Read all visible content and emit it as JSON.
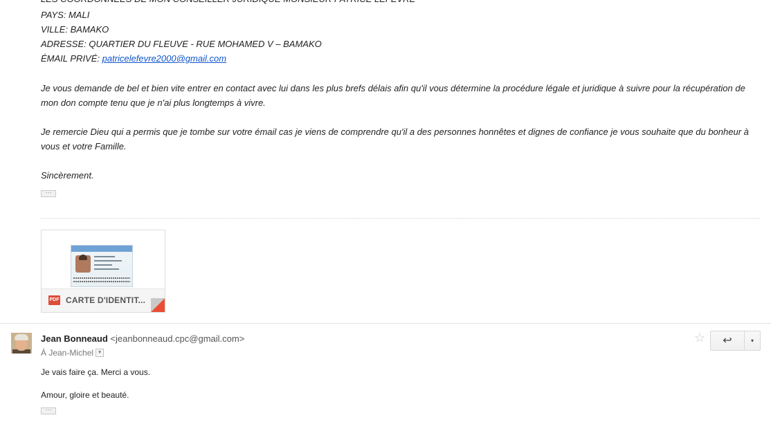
{
  "message1": {
    "cut_line": "LES COORDONNÉES DE MON CONSEILLER JURIDIQUE MONSIEUR PATRICE LEFEVRE",
    "pays": "PAYS: MALI",
    "ville": "VILLE: BAMAKO",
    "adresse": "ADRESSE: QUARTIER DU FLEUVE - RUE MOHAMED V – BAMAKO",
    "email_label": "ÉMAIL PRIVÉ: ",
    "email_link": "patricelefevre2000@gmail.com",
    "para1": "Je vous demande de bel et bien vite entrer en contact avec lui dans les plus brefs délais afin qu'il vous détermine la procédure légale et juridique à suivre pour la récupération de mon don compte tenu que je n'ai plus longtemps à vivre.",
    "para2": "Je remercie Dieu qui a permis que je tombe sur votre émail cas je viens de comprendre qu'il a des personnes honnêtes et dignes de confiance je vous souhaite que du bonheur à vous et votre Famille.",
    "closing": "Sincèrement.",
    "show_trimmed": "···"
  },
  "attachment": {
    "type_badge": "PDF",
    "name": "CARTE D'IDENTIT...",
    "icon": "id-card-thumbnail"
  },
  "message2": {
    "sender_name": "Jean Bonneaud",
    "sender_email": "<jeanbonneaud.cpc@gmail.com>",
    "to": "À Jean-Michel",
    "to_arrow": "▾",
    "star": "☆",
    "reply_icon": "↩",
    "more_icon": "▾",
    "line1": "Je vais faire ça. Merci a vous.",
    "line2": "Amour, gloire et beauté.",
    "show_trimmed": "···"
  }
}
